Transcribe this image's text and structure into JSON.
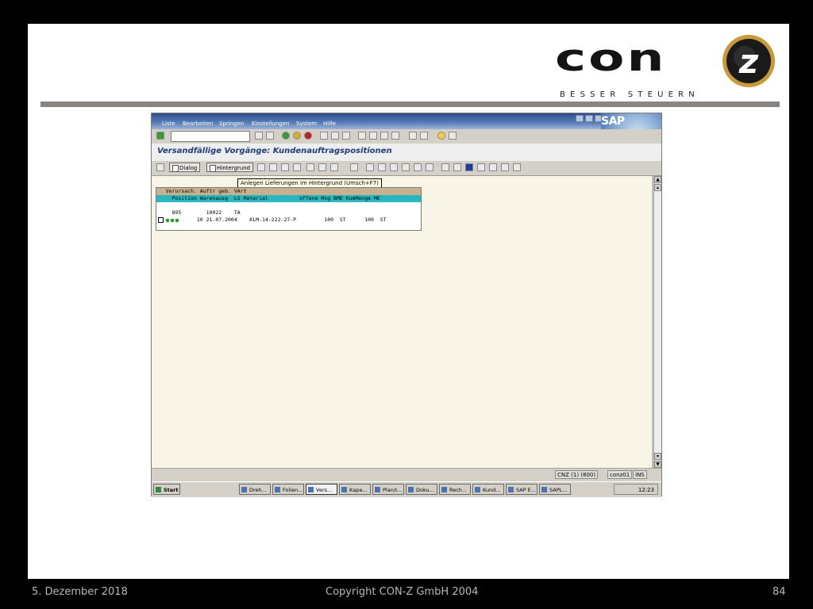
{
  "logo": {
    "wordmark": "con",
    "badge_letter": "z",
    "tagline": "BESSER STEUERN"
  },
  "footer": {
    "date": "5. Dezember 2018",
    "copyright": "Copyright CON-Z GmbH 2004",
    "page": "84"
  },
  "sap": {
    "menu": [
      "Liste",
      "Bearbeiten",
      "Springen",
      "Einstellungen",
      "System",
      "Hilfe"
    ],
    "logo_text": "SAP",
    "screen_title": "Versandfällige Vorgänge: Kundenauftragspositionen",
    "toolbar": {
      "dialog_label": "Dialog",
      "background_label": "Hintergrund"
    },
    "tooltip": "Anlegen Lieferungen im Hintergrund  (Umsch+F7)",
    "grid": {
      "header_line1": "   Verursach. Auftr geb. VArt",
      "header_line2": "     Position Warenausg  LS Material          offene Mng BME KumMenge ME",
      "row1": "     895        10022    TA",
      "row2": "             10 21.07.2004    KLM-14-222-27-P         100  ST      100  ST"
    },
    "status": {
      "system": "CNZ (1) (800)",
      "user": "conz01",
      "mode": "INS"
    },
    "taskbar": {
      "start": "Start",
      "tasks": [
        "Dreh...",
        "Folien...",
        "Vers...",
        "Kapa...",
        "Plan/I...",
        "Doku...",
        "Rech...",
        "Kund...",
        "SAP E...",
        "SAPL..."
      ],
      "active_task": 2,
      "clock": "12:23"
    },
    "colors": {
      "menubar": "#2a4e8e",
      "title": "#1c3e7a",
      "content_bg": "#f8f4e6",
      "header1": "#c8b090",
      "header2": "#2ab8c0"
    }
  }
}
